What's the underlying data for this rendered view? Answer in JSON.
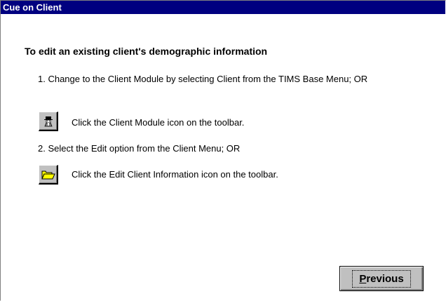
{
  "window": {
    "title": "Cue on Client"
  },
  "content": {
    "heading": "To edit an existing client's demographic information",
    "step1_text": "1. Change to the Client Module by selecting Client from the TIMS Base Menu; OR",
    "client_icon_description": "Click the Client Module icon on the toolbar.",
    "step2_text": "2. Select the Edit option from the Client Menu; OR",
    "edit_icon_description": "Click the Edit Client Information icon on the toolbar."
  },
  "icons": {
    "client_module": "client-module-icon",
    "edit_client": "folder-open-icon"
  },
  "buttons": {
    "previous_mnemonic": "P",
    "previous_rest": "revious"
  },
  "colors": {
    "titlebar": "#000080",
    "button_face": "#c0c0c0",
    "folder": "#ffff00"
  }
}
